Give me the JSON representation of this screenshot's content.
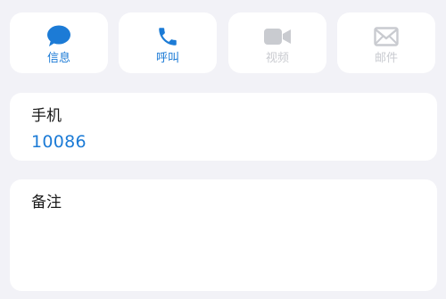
{
  "actions": [
    {
      "label": "信息",
      "icon": "message-bubble-icon",
      "enabled": true
    },
    {
      "label": "呼叫",
      "icon": "phone-icon",
      "enabled": true
    },
    {
      "label": "视频",
      "icon": "video-camera-icon",
      "enabled": false
    },
    {
      "label": "邮件",
      "icon": "envelope-icon",
      "enabled": false
    }
  ],
  "phone": {
    "label": "手机",
    "number": "10086"
  },
  "notes": {
    "label": "备注",
    "value": ""
  },
  "colors": {
    "background": "#f2f2f7",
    "accent": "#1c7bd6",
    "disabled": "#c9cbd0",
    "card": "#ffffff"
  }
}
